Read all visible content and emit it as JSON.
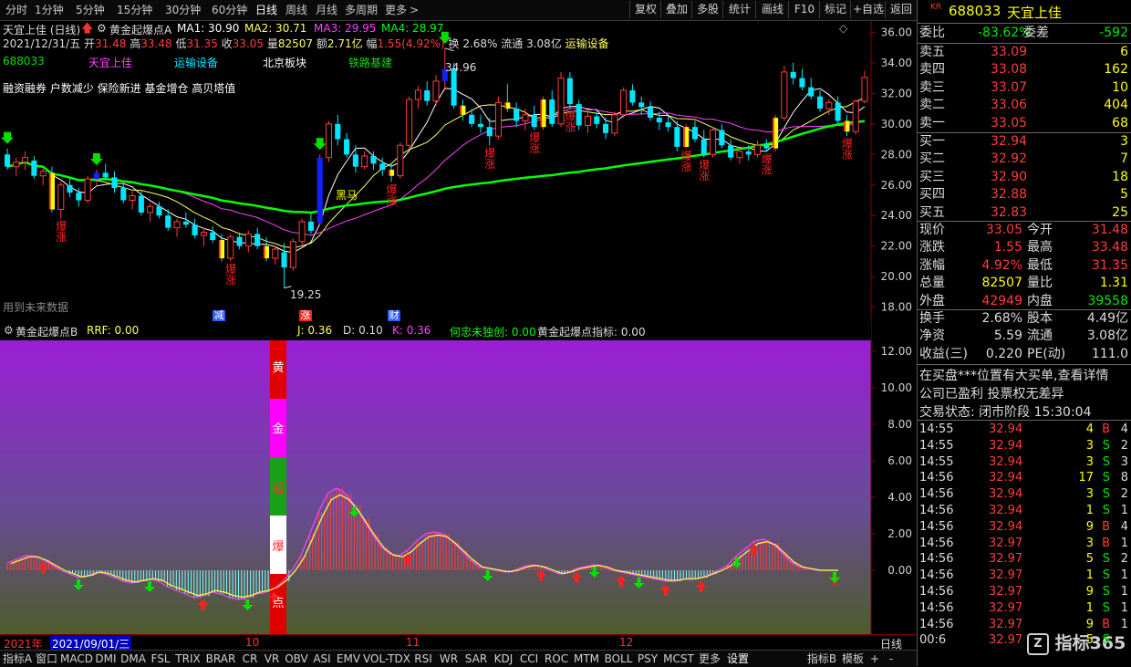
{
  "toolbar": {
    "periods": [
      "分时",
      "1分钟",
      "5分钟",
      "15分钟",
      "30分钟",
      "60分钟",
      "日线",
      "周线",
      "月线",
      "多周期",
      "更多"
    ],
    "active": "日线",
    "tools": [
      "复权",
      "叠加",
      "多股",
      "统计",
      "画线",
      "F10",
      "标记",
      "+自选",
      "返回"
    ],
    "more_arrow": ">"
  },
  "header": {
    "stock": "天宜上佳 (日线)",
    "indicator": "黄金起爆点A",
    "ma1": "MA1: 30.90",
    "ma2": "MA2: 30.71",
    "ma3": "MA3: 29.95",
    "ma4": "MA4: 28.97",
    "date": "2021/12/31/五",
    "open_label": "开",
    "open": "31.48",
    "high_label": "高",
    "high": "33.48",
    "low_label": "低",
    "low": "31.35",
    "close_label": "收",
    "close": "33.05",
    "vol_label": "量",
    "vol": "82507",
    "amt_label": "额",
    "amt": "2.71亿",
    "chg_label": "幅",
    "chg": "1.55(4.92%)",
    "turn": "换 2.68%",
    "float": "流通 3.08亿",
    "sector": "运输设备",
    "code": "688033",
    "name": "天宜上佳",
    "tag1": "运输设备",
    "tag2": "北京板块",
    "tag3": "铁路基建",
    "notes": "融资融券 户数减少 保险新进 基金增仓 高贝塔值",
    "hi_mark": "34.96",
    "lo_mark": "19.25",
    "future": "用到未来数据",
    "evt1": "减",
    "evt2": "涨",
    "evt3": "财",
    "sign_text": "黑马",
    "burst": "爆涨"
  },
  "sub": {
    "title": "黄金起爆点B",
    "rrf": "RRF: 0.00",
    "j": "J: 0.36",
    "d": "D: 0.10",
    "k": "K: 0.36",
    "hzw": "何忠未独创: 0.00",
    "idx": "黄金起爆点指标: 0.00",
    "bar_chars": [
      "黄",
      "金",
      "起",
      "爆",
      "点"
    ]
  },
  "date_bar": {
    "year": "2021年",
    "date": "2021/09/01/三",
    "m10": "10",
    "m11": "11",
    "m12": "12",
    "period": "日线"
  },
  "bottom": {
    "tabs": [
      "指标A",
      "窗口",
      "MACD",
      "DMI",
      "DMA",
      "FSL",
      "TRIX",
      "BRAR",
      "CR",
      "VR",
      "OBV",
      "ASI",
      "EMV",
      "VOL-TDX",
      "RSI",
      "WR",
      "SAR",
      "KDJ",
      "CCI",
      "ROC",
      "MTM",
      "BOLL",
      "PSY",
      "MCST",
      "更多",
      "设置",
      "指标B",
      "模板",
      "+",
      "-"
    ]
  },
  "panel": {
    "code": "688033",
    "name": "天宜上佳",
    "badge": "KR",
    "wb_label": "委比",
    "wb": "-83.62%",
    "wc_label": "委差",
    "wc": "-592",
    "asks": [
      {
        "l": "卖五",
        "p": "33.09",
        "v": "6"
      },
      {
        "l": "卖四",
        "p": "33.08",
        "v": "162"
      },
      {
        "l": "卖三",
        "p": "33.07",
        "v": "10"
      },
      {
        "l": "卖二",
        "p": "33.06",
        "v": "404"
      },
      {
        "l": "卖一",
        "p": "33.05",
        "v": "68"
      }
    ],
    "bids": [
      {
        "l": "买一",
        "p": "32.94",
        "v": "3"
      },
      {
        "l": "买二",
        "p": "32.92",
        "v": "7"
      },
      {
        "l": "买三",
        "p": "32.90",
        "v": "18"
      },
      {
        "l": "买四",
        "p": "32.88",
        "v": "5"
      },
      {
        "l": "买五",
        "p": "32.83",
        "v": "25"
      }
    ],
    "q": [
      {
        "a": "现价",
        "b": "33.05",
        "c": "今开",
        "d": "31.48"
      },
      {
        "a": "涨跌",
        "b": "1.55",
        "c": "最高",
        "d": "33.48"
      },
      {
        "a": "涨幅",
        "b": "4.92%",
        "c": "最低",
        "d": "31.35"
      },
      {
        "a": "总量",
        "b": "82507",
        "c": "量比",
        "d": "1.31"
      },
      {
        "a": "外盘",
        "b": "42949",
        "c": "内盘",
        "d": "39558"
      }
    ],
    "f": [
      {
        "a": "换手",
        "b": "2.68%",
        "c": "股本",
        "d": "4.49亿"
      },
      {
        "a": "净资",
        "b": "5.59",
        "c": "流通",
        "d": "3.08亿"
      },
      {
        "a": "收益(三)",
        "b": "0.220",
        "c": "PE(动)",
        "d": "111.0"
      }
    ],
    "msg1": "在买盘***位置有大买单,查看详情",
    "msg2": "公司已盈利 投票权无差异",
    "status": "交易状态: 闭市阶段 15:30:04",
    "ticks": [
      {
        "t": "14:55",
        "p": "32.94",
        "v": "4",
        "s": "B",
        "n": "4"
      },
      {
        "t": "14:55",
        "p": "32.94",
        "v": "3",
        "s": "S",
        "n": "2"
      },
      {
        "t": "14:55",
        "p": "32.94",
        "v": "3",
        "s": "S",
        "n": "3"
      },
      {
        "t": "14:56",
        "p": "32.94",
        "v": "17",
        "s": "S",
        "n": "8"
      },
      {
        "t": "14:56",
        "p": "32.94",
        "v": "3",
        "s": "S",
        "n": "2"
      },
      {
        "t": "14:56",
        "p": "32.94",
        "v": "1",
        "s": "S",
        "n": "1"
      },
      {
        "t": "14:56",
        "p": "32.94",
        "v": "9",
        "s": "B",
        "n": "4"
      },
      {
        "t": "14:56",
        "p": "32.97",
        "v": "3",
        "s": "B",
        "n": "1"
      },
      {
        "t": "14:56",
        "p": "32.97",
        "v": "5",
        "s": "S",
        "n": "2"
      },
      {
        "t": "14:56",
        "p": "32.97",
        "v": "1",
        "s": "S",
        "n": "1"
      },
      {
        "t": "14:56",
        "p": "32.97",
        "v": "9",
        "s": "S",
        "n": "1"
      },
      {
        "t": "14:56",
        "p": "32.97",
        "v": "1",
        "s": "S",
        "n": "1"
      },
      {
        "t": "14:56",
        "p": "32.97",
        "v": "9",
        "s": "B",
        "n": "1"
      },
      {
        "t": "00:6",
        "p": "32.97",
        "v": "5",
        "s": "S",
        "n": ""
      }
    ],
    "watermark": "指标365"
  },
  "main_axis": [
    "36.00",
    "34.00",
    "32.00",
    "30.00",
    "28.00",
    "26.00",
    "24.00",
    "22.00",
    "20.00",
    "18.00"
  ],
  "sub_axis": [
    "12.00",
    "10.00",
    "8.00",
    "6.00",
    "4.00",
    "2.00",
    "0.00"
  ],
  "colors": {
    "up": "#ff3c3c",
    "down": "#00e5ff",
    "ma1": "#ffffff",
    "ma2": "#ffff60",
    "ma3": "#ff40ff",
    "ma4": "#00ff00"
  },
  "chart_data": {
    "type": "candlestick",
    "ylim": [
      17.8,
      36.8
    ],
    "candles": [
      [
        28.0,
        28.4,
        27.0,
        27.2
      ],
      [
        27.2,
        27.8,
        26.6,
        27.5
      ],
      [
        27.5,
        28.2,
        27.0,
        27.8
      ],
      [
        27.6,
        27.9,
        26.4,
        26.6
      ],
      [
        26.6,
        27.1,
        26.0,
        26.9
      ],
      [
        26.8,
        27.2,
        24.2,
        24.4
      ],
      [
        24.4,
        26.2,
        23.8,
        26.0
      ],
      [
        26.0,
        26.5,
        25.2,
        25.5
      ],
      [
        25.5,
        25.8,
        24.6,
        25.0
      ],
      [
        25.0,
        26.6,
        24.8,
        26.4
      ],
      [
        26.4,
        27.0,
        26.0,
        26.8
      ],
      [
        26.8,
        27.4,
        26.3,
        26.5
      ],
      [
        26.5,
        26.9,
        25.5,
        25.8
      ],
      [
        25.8,
        26.2,
        24.8,
        25.0
      ],
      [
        25.0,
        25.6,
        24.4,
        25.3
      ],
      [
        25.3,
        25.6,
        24.0,
        24.2
      ],
      [
        24.2,
        24.8,
        23.6,
        24.6
      ],
      [
        24.6,
        24.9,
        23.8,
        24.0
      ],
      [
        24.0,
        24.4,
        23.0,
        23.2
      ],
      [
        23.2,
        23.8,
        22.6,
        23.6
      ],
      [
        23.6,
        24.2,
        23.2,
        23.4
      ],
      [
        23.4,
        23.8,
        22.5,
        22.7
      ],
      [
        22.7,
        23.2,
        22.0,
        22.9
      ],
      [
        22.9,
        23.3,
        22.2,
        22.4
      ],
      [
        22.4,
        22.8,
        21.0,
        21.2
      ],
      [
        21.2,
        22.8,
        21.0,
        22.6
      ],
      [
        22.6,
        22.9,
        21.8,
        22.0
      ],
      [
        22.0,
        23.0,
        21.6,
        22.8
      ],
      [
        22.8,
        23.2,
        21.8,
        22.0
      ],
      [
        22.0,
        22.6,
        21.0,
        21.2
      ],
      [
        21.2,
        22.0,
        20.8,
        21.8
      ],
      [
        21.6,
        22.2,
        19.25,
        20.6
      ],
      [
        20.6,
        22.5,
        20.4,
        22.3
      ],
      [
        22.3,
        23.8,
        22.0,
        23.6
      ],
      [
        23.6,
        24.2,
        22.8,
        23.0
      ],
      [
        23.5,
        28.0,
        23.4,
        27.8
      ],
      [
        27.8,
        30.2,
        27.5,
        30.0
      ],
      [
        30.0,
        30.6,
        28.6,
        29.0
      ],
      [
        29.0,
        29.4,
        27.8,
        28.0
      ],
      [
        28.0,
        28.6,
        26.8,
        27.2
      ],
      [
        27.2,
        28.2,
        27.0,
        27.9
      ],
      [
        27.9,
        28.2,
        27.0,
        27.4
      ],
      [
        27.4,
        27.8,
        26.6,
        27.0
      ],
      [
        27.0,
        27.4,
        26.2,
        26.6
      ],
      [
        26.6,
        28.8,
        26.4,
        28.6
      ],
      [
        28.6,
        31.8,
        28.4,
        31.6
      ],
      [
        31.6,
        32.5,
        31.0,
        32.2
      ],
      [
        32.2,
        32.8,
        31.2,
        31.5
      ],
      [
        31.5,
        33.2,
        31.2,
        32.8
      ],
      [
        32.8,
        34.96,
        32.2,
        33.6
      ],
      [
        33.6,
        34.0,
        31.0,
        31.2
      ],
      [
        31.2,
        31.6,
        30.2,
        30.6
      ],
      [
        30.6,
        31.0,
        29.8,
        30.0
      ],
      [
        30.0,
        30.6,
        29.4,
        29.8
      ],
      [
        29.8,
        30.4,
        28.6,
        29.2
      ],
      [
        29.2,
        31.8,
        29.0,
        31.4
      ],
      [
        31.4,
        32.6,
        30.8,
        31.0
      ],
      [
        31.0,
        31.4,
        29.8,
        30.2
      ],
      [
        30.2,
        31.0,
        29.6,
        30.6
      ],
      [
        30.6,
        31.2,
        29.6,
        29.8
      ],
      [
        29.8,
        31.8,
        29.6,
        31.6
      ],
      [
        31.6,
        32.2,
        29.8,
        30.0
      ],
      [
        30.0,
        33.4,
        29.8,
        33.0
      ],
      [
        33.0,
        33.4,
        31.0,
        31.3
      ],
      [
        31.3,
        31.6,
        29.6,
        29.9
      ],
      [
        29.9,
        30.8,
        29.4,
        30.5
      ],
      [
        30.5,
        30.9,
        29.7,
        30.0
      ],
      [
        30.0,
        30.4,
        29.0,
        29.4
      ],
      [
        29.4,
        30.8,
        29.2,
        30.6
      ],
      [
        30.6,
        32.4,
        30.4,
        32.2
      ],
      [
        32.2,
        32.6,
        31.2,
        31.4
      ],
      [
        31.4,
        31.8,
        30.6,
        31.1
      ],
      [
        31.1,
        31.5,
        30.2,
        30.4
      ],
      [
        30.4,
        30.8,
        29.6,
        30.1
      ],
      [
        30.1,
        30.5,
        29.5,
        29.8
      ],
      [
        29.8,
        30.2,
        28.2,
        28.5
      ],
      [
        28.5,
        30.0,
        28.4,
        29.8
      ],
      [
        29.8,
        30.2,
        28.8,
        29.0
      ],
      [
        29.0,
        29.6,
        27.8,
        28.0
      ],
      [
        28.0,
        29.8,
        27.8,
        29.6
      ],
      [
        29.6,
        30.0,
        28.4,
        28.6
      ],
      [
        28.6,
        29.0,
        27.6,
        27.8
      ],
      [
        27.8,
        28.4,
        27.4,
        28.2
      ],
      [
        28.2,
        28.6,
        27.6,
        28.0
      ],
      [
        28.0,
        28.9,
        27.8,
        28.6
      ],
      [
        28.6,
        29.0,
        28.2,
        28.4
      ],
      [
        28.4,
        30.6,
        28.2,
        30.4
      ],
      [
        30.4,
        33.8,
        30.2,
        33.4
      ],
      [
        33.4,
        34.0,
        32.6,
        33.0
      ],
      [
        33.0,
        33.6,
        32.2,
        32.4
      ],
      [
        32.4,
        33.0,
        31.6,
        31.8
      ],
      [
        31.8,
        32.2,
        30.8,
        31.0
      ],
      [
        31.0,
        31.6,
        30.6,
        31.4
      ],
      [
        31.4,
        31.8,
        30.0,
        30.2
      ],
      [
        30.2,
        30.6,
        29.2,
        29.5
      ],
      [
        29.5,
        31.6,
        29.3,
        31.48
      ],
      [
        31.48,
        33.48,
        31.35,
        33.05
      ]
    ],
    "yellow_idx": [
      5,
      24,
      29,
      43,
      51,
      56,
      60,
      76,
      86,
      94
    ],
    "blue_idx": [
      10,
      35,
      49
    ],
    "burst_idx": [
      6,
      25,
      43,
      54,
      59,
      63,
      76,
      78,
      85,
      94
    ],
    "sub_ylim": [
      -3.5,
      12.6
    ],
    "sub_line": [
      0.4,
      0.6,
      0.8,
      0.8,
      0.6,
      0.3,
      0.0,
      -0.2,
      -0.4,
      -0.3,
      -0.1,
      -0.2,
      -0.4,
      -0.6,
      -0.7,
      -0.6,
      -0.5,
      -0.6,
      -0.9,
      -1.1,
      -1.3,
      -1.5,
      -1.4,
      -1.2,
      -1.3,
      -1.5,
      -1.6,
      -1.5,
      -1.3,
      -1.2,
      -1.0,
      -0.6,
      0.0,
      0.8,
      2.0,
      3.2,
      4.2,
      4.5,
      4.2,
      3.6,
      2.8,
      2.0,
      1.3,
      0.9,
      0.8,
      1.1,
      1.6,
      2.0,
      2.1,
      2.0,
      1.6,
      1.1,
      0.6,
      0.2,
      0.1,
      0.0,
      -0.1,
      0.0,
      0.2,
      0.3,
      0.2,
      0.0,
      -0.2,
      -0.1,
      0.1,
      0.2,
      0.3,
      0.2,
      0.0,
      -0.1,
      -0.2,
      -0.3,
      -0.4,
      -0.5,
      -0.6,
      -0.6,
      -0.5,
      -0.5,
      -0.4,
      -0.2,
      0.0,
      0.3,
      0.8,
      1.2,
      1.6,
      1.7,
      1.5,
      1.0,
      0.5,
      0.2,
      0.1,
      0.0,
      0.0,
      0.0
    ],
    "sub_red": [
      1.2,
      1.4,
      1.5,
      1.4,
      1.0,
      0.6,
      0.2
    ],
    "sub_arrows_up": [
      4,
      22,
      30,
      45,
      60,
      64,
      69,
      74,
      78,
      84,
      96
    ],
    "sub_arrows_down": [
      8,
      16,
      27,
      39,
      54,
      66,
      71,
      82,
      94
    ]
  }
}
